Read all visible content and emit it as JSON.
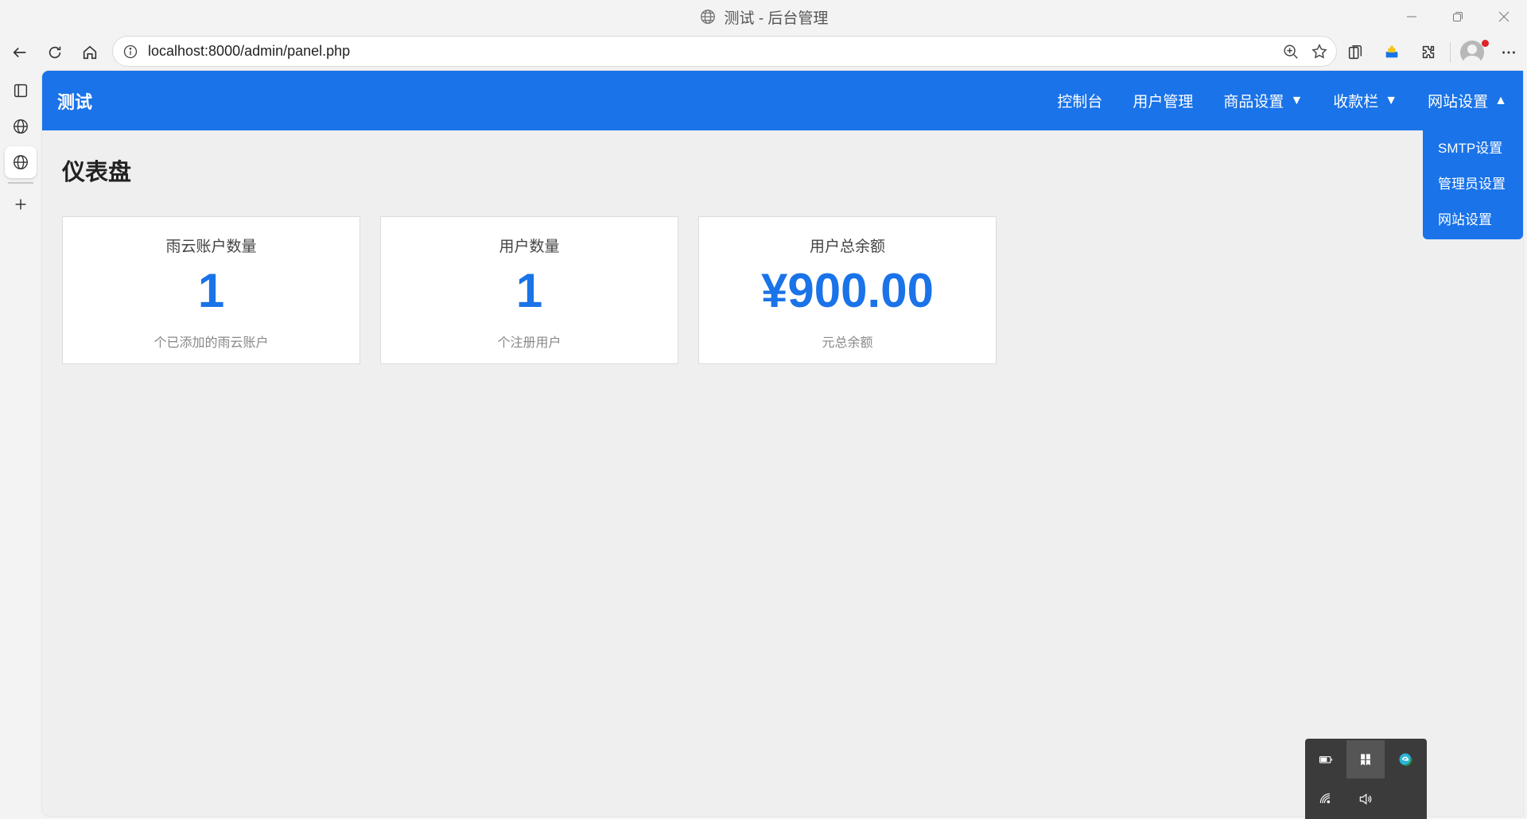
{
  "window": {
    "title": "测试 - 后台管理"
  },
  "browser": {
    "url": "localhost:8000/admin/panel.php"
  },
  "navbar": {
    "brand": "测试",
    "links": [
      {
        "label": "控制台",
        "caret": ""
      },
      {
        "label": "用户管理",
        "caret": ""
      },
      {
        "label": "商品设置",
        "caret": "▼"
      },
      {
        "label": "收款栏",
        "caret": "▼"
      },
      {
        "label": "网站设置",
        "caret": "▲"
      }
    ],
    "dropdown": [
      "SMTP设置",
      "管理员设置",
      "网站设置"
    ]
  },
  "page": {
    "title": "仪表盘"
  },
  "cards": [
    {
      "title": "雨云账户数量",
      "value": "1",
      "desc": "个已添加的雨云账户"
    },
    {
      "title": "用户数量",
      "value": "1",
      "desc": "个注册用户"
    },
    {
      "title": "用户总余额",
      "value": "¥900.00",
      "desc": "元总余额"
    }
  ],
  "colors": {
    "accent": "#1a73e8",
    "background": "#efefef",
    "tray": "#3b3b3b"
  }
}
